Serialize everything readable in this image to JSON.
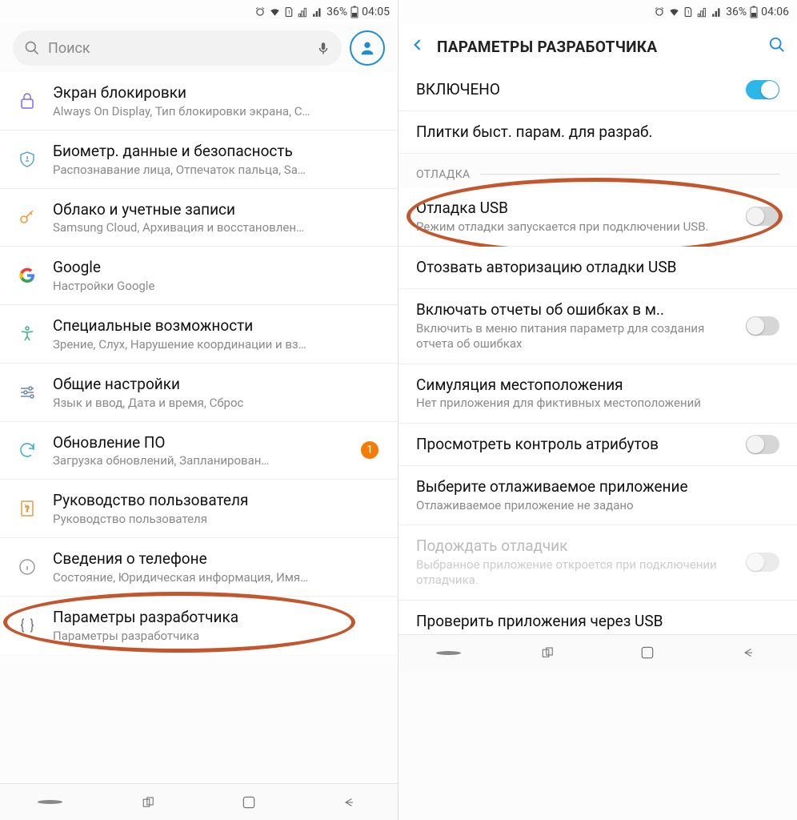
{
  "status": {
    "battery_pct": "36%",
    "time_left": "04:05",
    "time_right": "04:06"
  },
  "left": {
    "search_placeholder": "Поиск",
    "items": [
      {
        "icon": "lock",
        "title": "Экран блокировки",
        "sub": "Always On Display, Тип блокировки экрана, С…"
      },
      {
        "icon": "shield",
        "title": "Биометр. данные и безопасность",
        "sub": "Распознавание лица, Отпечаток пальца, Sa…"
      },
      {
        "icon": "key",
        "title": "Облако и учетные записи",
        "sub": "Samsung Cloud, Архивация и восстановлен…"
      },
      {
        "icon": "google",
        "title": "Google",
        "sub": "Настройки Google"
      },
      {
        "icon": "access",
        "title": "Специальные возможности",
        "sub": "Зрение, Слух, Нарушение координации и вз…"
      },
      {
        "icon": "sliders",
        "title": "Общие настройки",
        "sub": "Язык и ввод, Дата и время, Сброс"
      },
      {
        "icon": "update",
        "title": "Обновление ПО",
        "sub": "Загрузка обновлений, Запланирован…",
        "badge": "1"
      },
      {
        "icon": "book",
        "title": "Руководство пользователя",
        "sub": "Руководство пользователя"
      },
      {
        "icon": "info",
        "title": "Сведения о телефоне",
        "sub": "Состояние, Юридическая информация, Имя…"
      },
      {
        "icon": "braces",
        "title": "Параметры разработчика",
        "sub": "Параметры разработчика"
      }
    ]
  },
  "right": {
    "header": "ПАРАМЕТРЫ РАЗРАБОТЧИКА",
    "enabled_label": "ВКЛЮЧЕНО",
    "tiles_label": "Плитки быст. парам. для разраб.",
    "section_debug": "ОТЛАДКА",
    "rows": [
      {
        "title": "Отладка USB",
        "sub": "Режим отладки запускается при подключении USB.",
        "toggle": "off"
      },
      {
        "title": "Отозвать авторизацию отладки USB"
      },
      {
        "title": "Включать отчеты об ошибках в м..",
        "sub": "Включить в меню питания параметр для создания отчета об ошибках",
        "toggle": "off"
      },
      {
        "title": "Симуляция местоположения",
        "sub": "Нет приложения для фиктивных местоположений"
      },
      {
        "title": "Просмотреть контроль атрибутов",
        "toggle": "off"
      },
      {
        "title": "Выберите отлаживаемое приложение",
        "sub": "Отлаживаемое приложение не задано"
      },
      {
        "title": "Подождать отладчик",
        "sub": "Выбранное приложение откроется при подключении отладчика.",
        "toggle": "off",
        "disabled": true
      },
      {
        "title": "Проверить приложения через USB"
      }
    ]
  }
}
